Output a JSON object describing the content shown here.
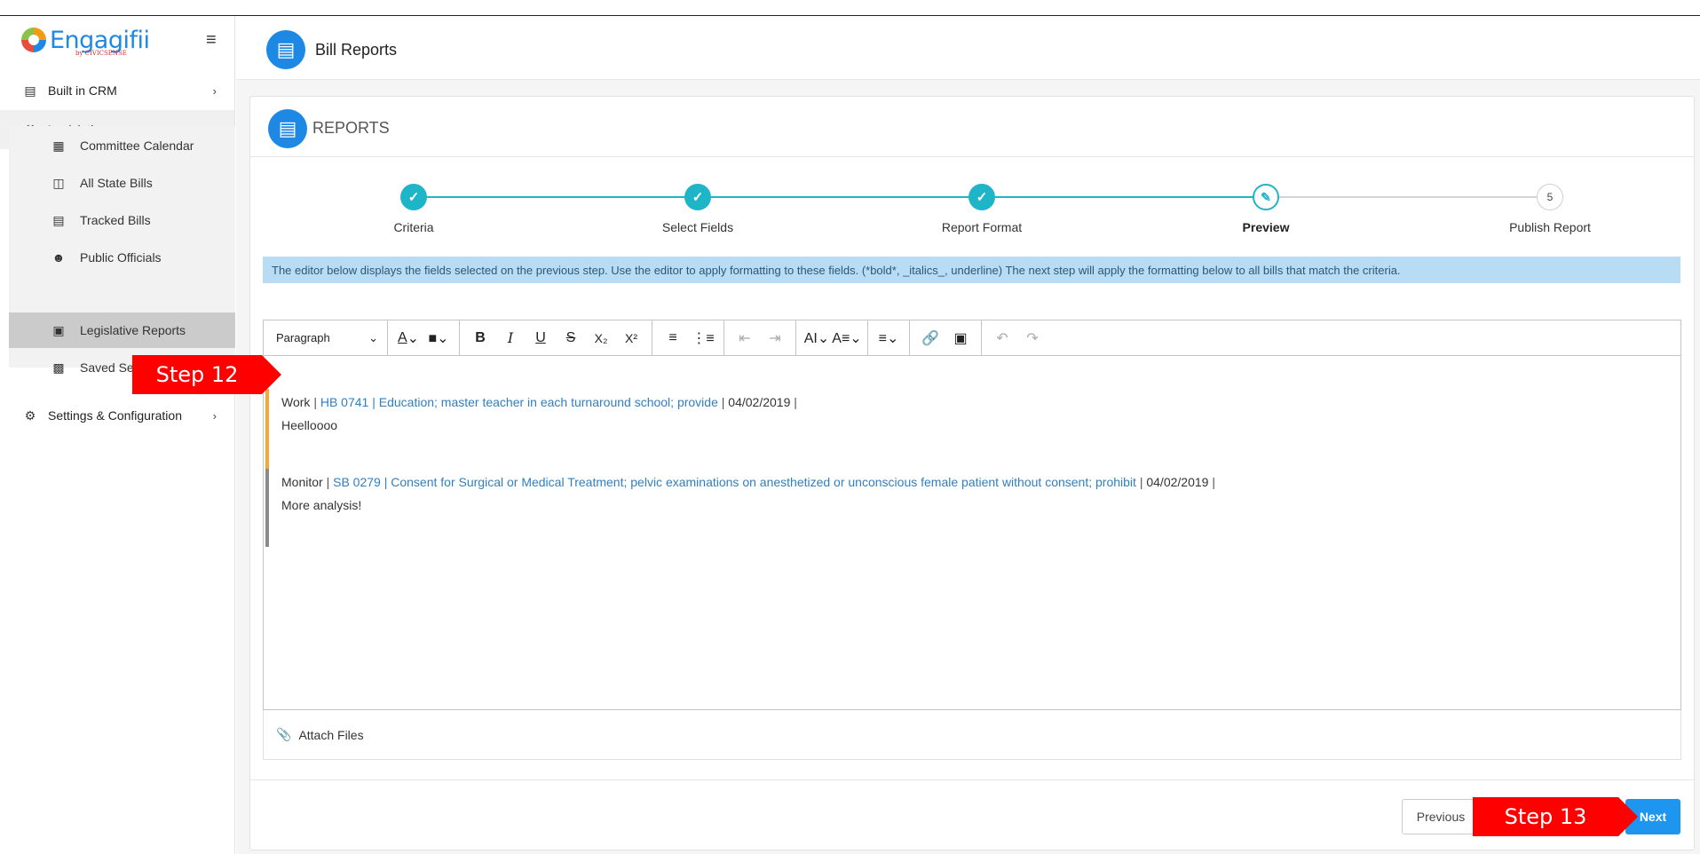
{
  "app": {
    "logo_text": "Engagifii",
    "logo_sub": "by CIVICSENSE"
  },
  "sidebar": {
    "items": [
      {
        "label": "Built in CRM",
        "icon": "server-icon"
      },
      {
        "label": "Legislation",
        "icon": "gavel-icon"
      },
      {
        "label": "Settings & Configuration",
        "icon": "gears-icon"
      }
    ],
    "sub_items": [
      {
        "label": "Committee Calendar",
        "icon": "calendar-icon"
      },
      {
        "label": "All State Bills",
        "icon": "documents-icon"
      },
      {
        "label": "Tracked Bills",
        "icon": "bill-icon"
      },
      {
        "label": "Public Officials",
        "icon": "people-icon"
      },
      {
        "label": "Legislative Reports",
        "icon": "report-icon"
      },
      {
        "label": "Saved Sea",
        "icon": "save-icon"
      }
    ]
  },
  "header": {
    "title": "Bill Reports"
  },
  "card": {
    "title": "REPORTS"
  },
  "stepper": {
    "steps": [
      {
        "label": "Criteria",
        "state": "done"
      },
      {
        "label": "Select Fields",
        "state": "done"
      },
      {
        "label": "Report Format",
        "state": "done"
      },
      {
        "label": "Preview",
        "state": "active"
      },
      {
        "label": "Publish Report",
        "state": "pending",
        "number": "5"
      }
    ]
  },
  "info": "The editor below displays the fields selected on the previous step. Use the editor to apply formatting to these fields. (*bold*, _italics_, underline) The next step will apply the formatting below to all bills that match the criteria.",
  "toolbar": {
    "paragraph": "Paragraph"
  },
  "entries": [
    {
      "status": "Work",
      "bill": "HB 0741",
      "title": "Education; master teacher in each turnaround school; provide",
      "date": "04/02/2019",
      "note": "Heelloooo",
      "accent": "#f3a833"
    },
    {
      "status": "Monitor",
      "bill": "SB 0279",
      "title": "Consent for Surgical or Medical Treatment; pelvic examinations on anesthetized or unconscious female patient without consent; prohibit",
      "date": "04/02/2019",
      "note": "More analysis!",
      "accent": "#8a8a8a"
    }
  ],
  "attach": {
    "label": "Attach Files"
  },
  "footer": {
    "previous": "Previous",
    "next": "Next"
  },
  "callouts": {
    "step12": "Step 12",
    "step13": "Step 13"
  },
  "colors": {
    "brand": "#1e88e5",
    "step": "#1fb5c9",
    "callout": "#ff0000"
  }
}
